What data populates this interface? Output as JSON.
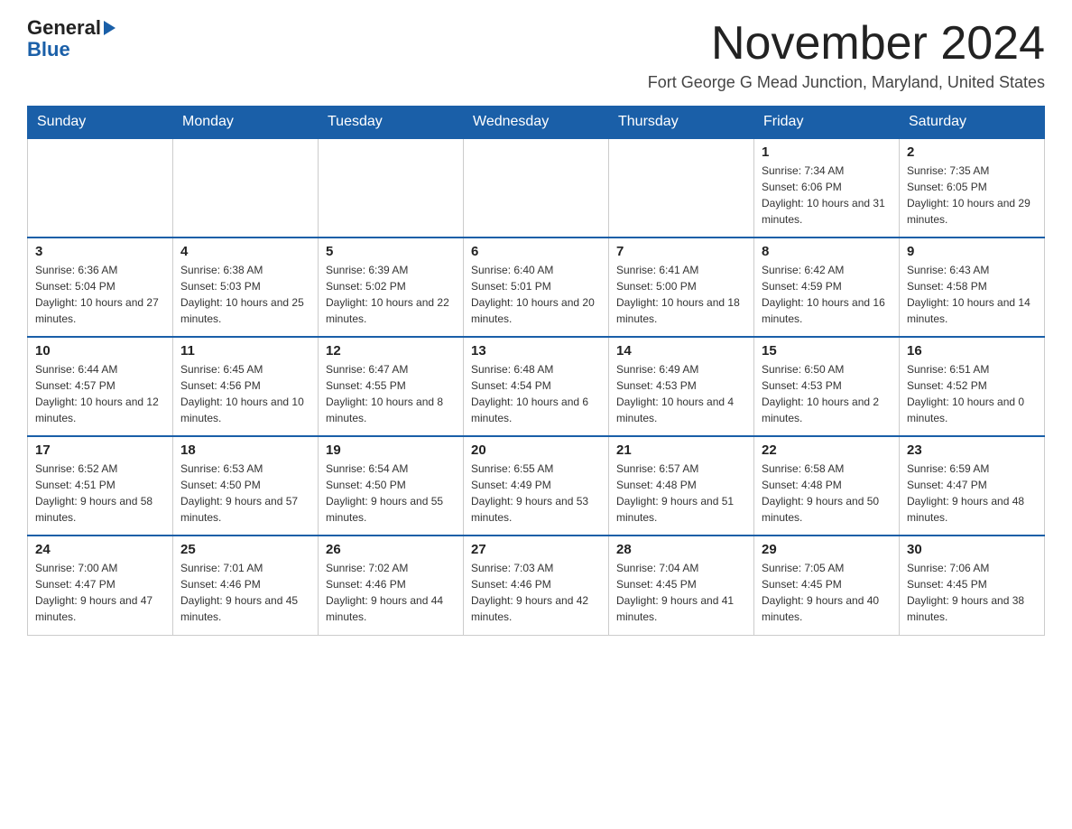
{
  "header": {
    "logo_general": "General",
    "logo_blue": "Blue",
    "month_title": "November 2024",
    "location": "Fort George G Mead Junction, Maryland, United States"
  },
  "weekdays": [
    "Sunday",
    "Monday",
    "Tuesday",
    "Wednesday",
    "Thursday",
    "Friday",
    "Saturday"
  ],
  "weeks": [
    [
      {
        "day": "",
        "sunrise": "",
        "sunset": "",
        "daylight": ""
      },
      {
        "day": "",
        "sunrise": "",
        "sunset": "",
        "daylight": ""
      },
      {
        "day": "",
        "sunrise": "",
        "sunset": "",
        "daylight": ""
      },
      {
        "day": "",
        "sunrise": "",
        "sunset": "",
        "daylight": ""
      },
      {
        "day": "",
        "sunrise": "",
        "sunset": "",
        "daylight": ""
      },
      {
        "day": "1",
        "sunrise": "Sunrise: 7:34 AM",
        "sunset": "Sunset: 6:06 PM",
        "daylight": "Daylight: 10 hours and 31 minutes."
      },
      {
        "day": "2",
        "sunrise": "Sunrise: 7:35 AM",
        "sunset": "Sunset: 6:05 PM",
        "daylight": "Daylight: 10 hours and 29 minutes."
      }
    ],
    [
      {
        "day": "3",
        "sunrise": "Sunrise: 6:36 AM",
        "sunset": "Sunset: 5:04 PM",
        "daylight": "Daylight: 10 hours and 27 minutes."
      },
      {
        "day": "4",
        "sunrise": "Sunrise: 6:38 AM",
        "sunset": "Sunset: 5:03 PM",
        "daylight": "Daylight: 10 hours and 25 minutes."
      },
      {
        "day": "5",
        "sunrise": "Sunrise: 6:39 AM",
        "sunset": "Sunset: 5:02 PM",
        "daylight": "Daylight: 10 hours and 22 minutes."
      },
      {
        "day": "6",
        "sunrise": "Sunrise: 6:40 AM",
        "sunset": "Sunset: 5:01 PM",
        "daylight": "Daylight: 10 hours and 20 minutes."
      },
      {
        "day": "7",
        "sunrise": "Sunrise: 6:41 AM",
        "sunset": "Sunset: 5:00 PM",
        "daylight": "Daylight: 10 hours and 18 minutes."
      },
      {
        "day": "8",
        "sunrise": "Sunrise: 6:42 AM",
        "sunset": "Sunset: 4:59 PM",
        "daylight": "Daylight: 10 hours and 16 minutes."
      },
      {
        "day": "9",
        "sunrise": "Sunrise: 6:43 AM",
        "sunset": "Sunset: 4:58 PM",
        "daylight": "Daylight: 10 hours and 14 minutes."
      }
    ],
    [
      {
        "day": "10",
        "sunrise": "Sunrise: 6:44 AM",
        "sunset": "Sunset: 4:57 PM",
        "daylight": "Daylight: 10 hours and 12 minutes."
      },
      {
        "day": "11",
        "sunrise": "Sunrise: 6:45 AM",
        "sunset": "Sunset: 4:56 PM",
        "daylight": "Daylight: 10 hours and 10 minutes."
      },
      {
        "day": "12",
        "sunrise": "Sunrise: 6:47 AM",
        "sunset": "Sunset: 4:55 PM",
        "daylight": "Daylight: 10 hours and 8 minutes."
      },
      {
        "day": "13",
        "sunrise": "Sunrise: 6:48 AM",
        "sunset": "Sunset: 4:54 PM",
        "daylight": "Daylight: 10 hours and 6 minutes."
      },
      {
        "day": "14",
        "sunrise": "Sunrise: 6:49 AM",
        "sunset": "Sunset: 4:53 PM",
        "daylight": "Daylight: 10 hours and 4 minutes."
      },
      {
        "day": "15",
        "sunrise": "Sunrise: 6:50 AM",
        "sunset": "Sunset: 4:53 PM",
        "daylight": "Daylight: 10 hours and 2 minutes."
      },
      {
        "day": "16",
        "sunrise": "Sunrise: 6:51 AM",
        "sunset": "Sunset: 4:52 PM",
        "daylight": "Daylight: 10 hours and 0 minutes."
      }
    ],
    [
      {
        "day": "17",
        "sunrise": "Sunrise: 6:52 AM",
        "sunset": "Sunset: 4:51 PM",
        "daylight": "Daylight: 9 hours and 58 minutes."
      },
      {
        "day": "18",
        "sunrise": "Sunrise: 6:53 AM",
        "sunset": "Sunset: 4:50 PM",
        "daylight": "Daylight: 9 hours and 57 minutes."
      },
      {
        "day": "19",
        "sunrise": "Sunrise: 6:54 AM",
        "sunset": "Sunset: 4:50 PM",
        "daylight": "Daylight: 9 hours and 55 minutes."
      },
      {
        "day": "20",
        "sunrise": "Sunrise: 6:55 AM",
        "sunset": "Sunset: 4:49 PM",
        "daylight": "Daylight: 9 hours and 53 minutes."
      },
      {
        "day": "21",
        "sunrise": "Sunrise: 6:57 AM",
        "sunset": "Sunset: 4:48 PM",
        "daylight": "Daylight: 9 hours and 51 minutes."
      },
      {
        "day": "22",
        "sunrise": "Sunrise: 6:58 AM",
        "sunset": "Sunset: 4:48 PM",
        "daylight": "Daylight: 9 hours and 50 minutes."
      },
      {
        "day": "23",
        "sunrise": "Sunrise: 6:59 AM",
        "sunset": "Sunset: 4:47 PM",
        "daylight": "Daylight: 9 hours and 48 minutes."
      }
    ],
    [
      {
        "day": "24",
        "sunrise": "Sunrise: 7:00 AM",
        "sunset": "Sunset: 4:47 PM",
        "daylight": "Daylight: 9 hours and 47 minutes."
      },
      {
        "day": "25",
        "sunrise": "Sunrise: 7:01 AM",
        "sunset": "Sunset: 4:46 PM",
        "daylight": "Daylight: 9 hours and 45 minutes."
      },
      {
        "day": "26",
        "sunrise": "Sunrise: 7:02 AM",
        "sunset": "Sunset: 4:46 PM",
        "daylight": "Daylight: 9 hours and 44 minutes."
      },
      {
        "day": "27",
        "sunrise": "Sunrise: 7:03 AM",
        "sunset": "Sunset: 4:46 PM",
        "daylight": "Daylight: 9 hours and 42 minutes."
      },
      {
        "day": "28",
        "sunrise": "Sunrise: 7:04 AM",
        "sunset": "Sunset: 4:45 PM",
        "daylight": "Daylight: 9 hours and 41 minutes."
      },
      {
        "day": "29",
        "sunrise": "Sunrise: 7:05 AM",
        "sunset": "Sunset: 4:45 PM",
        "daylight": "Daylight: 9 hours and 40 minutes."
      },
      {
        "day": "30",
        "sunrise": "Sunrise: 7:06 AM",
        "sunset": "Sunset: 4:45 PM",
        "daylight": "Daylight: 9 hours and 38 minutes."
      }
    ]
  ]
}
